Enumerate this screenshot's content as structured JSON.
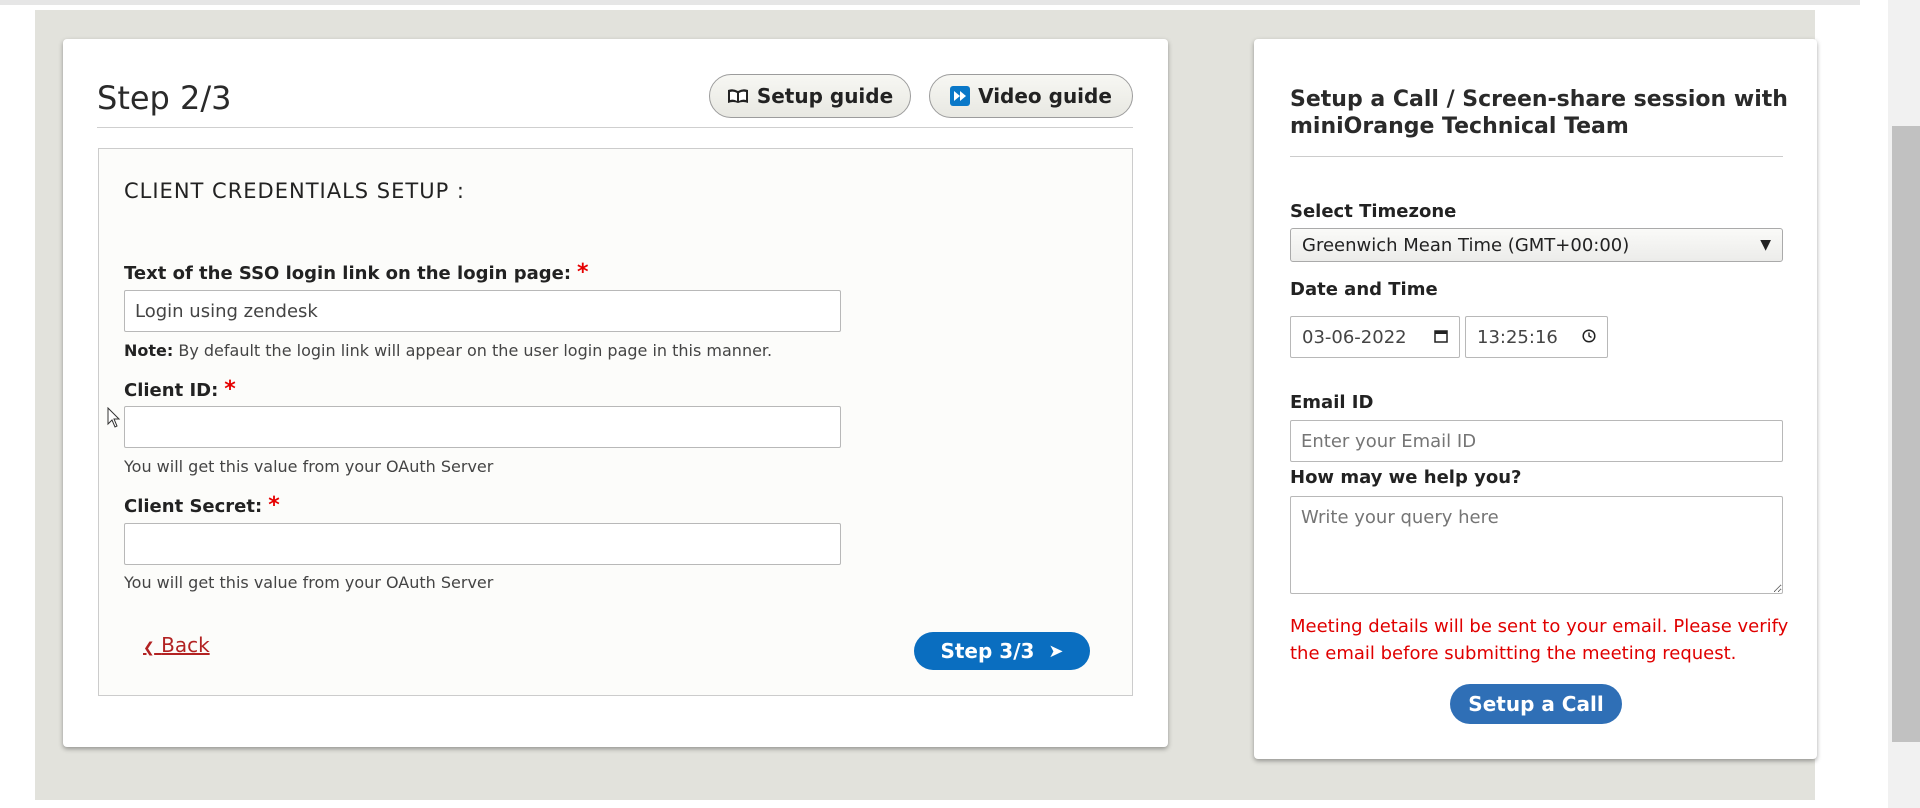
{
  "main": {
    "step_title": "Step 2/3",
    "setup_guide_label": "Setup guide",
    "video_guide_label": "Video guide",
    "section_title": "CLIENT CREDENTIALS SETUP :",
    "login_link_label": "Text of the SSO login link on the login page:",
    "login_link_value": "Login using zendesk",
    "note_prefix": "Note:",
    "note_text": " By default the login link will appear on the user login page in this manner.",
    "client_id_label": "Client ID:",
    "client_id_value": "",
    "client_id_help": "You will get this value from your OAuth Server",
    "client_secret_label": "Client Secret:",
    "client_secret_value": "",
    "client_secret_help": "You will get this value from your OAuth Server",
    "required_mark": "*",
    "back_label": "Back",
    "back_arrow": "❮",
    "next_label": "Step 3/3",
    "next_arrow": "➤"
  },
  "side": {
    "title": "Setup a Call / Screen-share session with miniOrange Technical Team",
    "timezone_label": "Select Timezone",
    "timezone_value": "Greenwich Mean Time (GMT+00:00)",
    "datetime_label": "Date and Time",
    "date_value": "03-06-2022",
    "time_value": "13:25:16",
    "email_label": "Email ID",
    "email_placeholder": "Enter your Email ID",
    "query_label": "How may we help you?",
    "query_placeholder": "Write your query here",
    "notice": "Meeting details will be sent to your email. Please verify the email before submitting the meeting request.",
    "call_button": "Setup a Call"
  },
  "icons": {
    "setup_guide": "book-icon",
    "video_guide": "play-icon",
    "date": "calendar-icon",
    "time": "clock-icon",
    "select": "caret-down-icon"
  },
  "colors": {
    "primary_button": "#0a6ec0",
    "call_button": "#2f6fb6",
    "required": "#e60000",
    "notice": "#e00000",
    "back_link": "#b22222",
    "page_background": "#e2e2dc"
  }
}
